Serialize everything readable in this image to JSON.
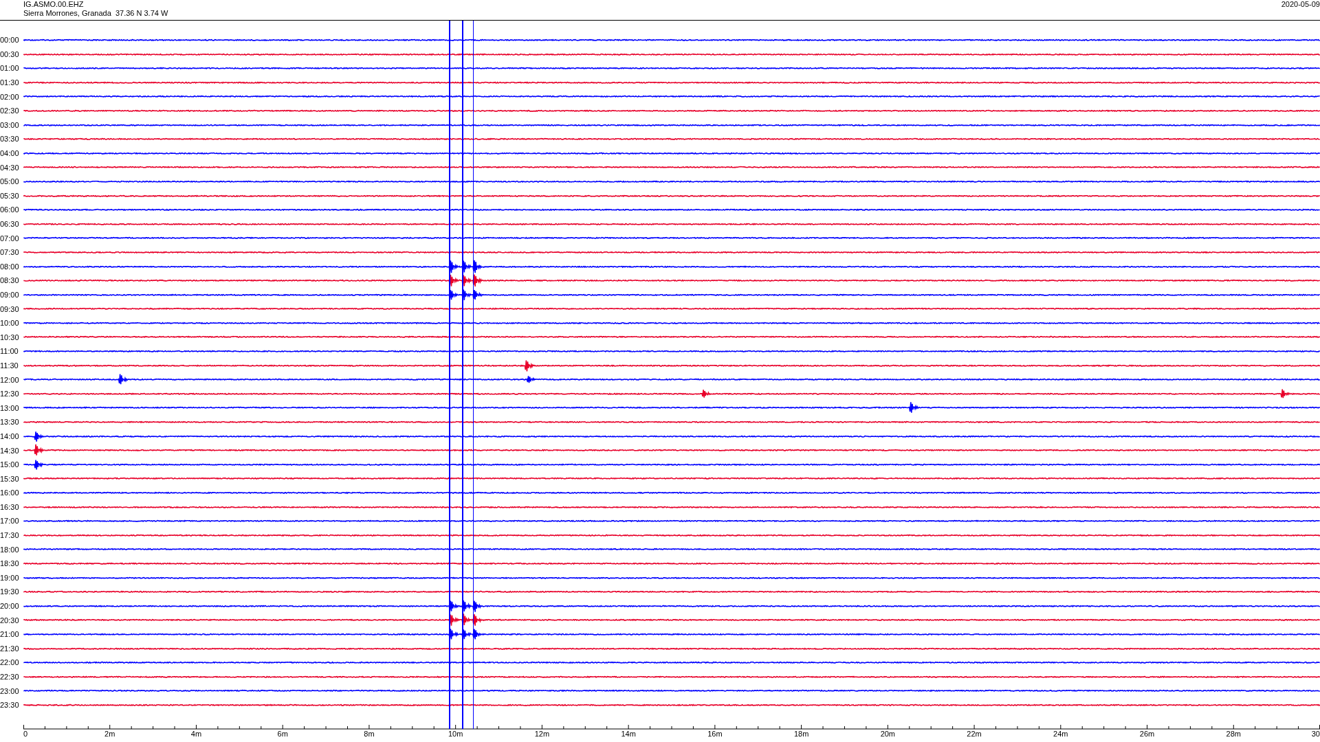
{
  "header": {
    "station": "IG.ASMO.00.EHZ",
    "location": "Sierra Morrones, Granada  37.36 N 3.74 W",
    "date": "2020-05-09"
  },
  "rows": [
    {
      "time": "00:00",
      "color": "#0000ff"
    },
    {
      "time": "00:30",
      "color": "#e8002a"
    },
    {
      "time": "01:00",
      "color": "#0000ff"
    },
    {
      "time": "01:30",
      "color": "#e8002a"
    },
    {
      "time": "02:00",
      "color": "#0000ff"
    },
    {
      "time": "02:30",
      "color": "#e8002a"
    },
    {
      "time": "03:00",
      "color": "#0000ff"
    },
    {
      "time": "03:30",
      "color": "#e8002a"
    },
    {
      "time": "04:00",
      "color": "#0000ff"
    },
    {
      "time": "04:30",
      "color": "#e8002a"
    },
    {
      "time": "05:00",
      "color": "#0000ff"
    },
    {
      "time": "05:30",
      "color": "#e8002a"
    },
    {
      "time": "06:00",
      "color": "#0000ff"
    },
    {
      "time": "06:30",
      "color": "#e8002a"
    },
    {
      "time": "07:00",
      "color": "#0000ff"
    },
    {
      "time": "07:30",
      "color": "#e8002a"
    },
    {
      "time": "08:00",
      "color": "#0000ff"
    },
    {
      "time": "08:30",
      "color": "#e8002a"
    },
    {
      "time": "09:00",
      "color": "#0000ff"
    },
    {
      "time": "09:30",
      "color": "#e8002a"
    },
    {
      "time": "10:00",
      "color": "#0000ff"
    },
    {
      "time": "10:30",
      "color": "#e8002a"
    },
    {
      "time": "11:00",
      "color": "#0000ff"
    },
    {
      "time": "11:30",
      "color": "#e8002a"
    },
    {
      "time": "12:00",
      "color": "#0000ff"
    },
    {
      "time": "12:30",
      "color": "#e8002a"
    },
    {
      "time": "13:00",
      "color": "#0000ff"
    },
    {
      "time": "13:30",
      "color": "#e8002a"
    },
    {
      "time": "14:00",
      "color": "#0000ff"
    },
    {
      "time": "14:30",
      "color": "#e8002a"
    },
    {
      "time": "15:00",
      "color": "#0000ff"
    },
    {
      "time": "15:30",
      "color": "#e8002a"
    },
    {
      "time": "16:00",
      "color": "#0000ff"
    },
    {
      "time": "16:30",
      "color": "#e8002a"
    },
    {
      "time": "17:00",
      "color": "#0000ff"
    },
    {
      "time": "17:30",
      "color": "#e8002a"
    },
    {
      "time": "18:00",
      "color": "#0000ff"
    },
    {
      "time": "18:30",
      "color": "#e8002a"
    },
    {
      "time": "19:00",
      "color": "#0000ff"
    },
    {
      "time": "19:30",
      "color": "#e8002a"
    },
    {
      "time": "20:00",
      "color": "#0000ff"
    },
    {
      "time": "20:30",
      "color": "#e8002a"
    },
    {
      "time": "21:00",
      "color": "#0000ff"
    },
    {
      "time": "21:30",
      "color": "#e8002a"
    },
    {
      "time": "22:00",
      "color": "#0000ff"
    },
    {
      "time": "22:30",
      "color": "#e8002a"
    },
    {
      "time": "23:00",
      "color": "#0000ff"
    },
    {
      "time": "23:30",
      "color": "#e8002a"
    }
  ],
  "axis": {
    "labels": [
      "0",
      "2m",
      "4m",
      "6m",
      "8m",
      "10m",
      "12m",
      "14m",
      "16m",
      "18m",
      "20m",
      "22m",
      "24m",
      "26m",
      "28m",
      "30"
    ]
  }
}
